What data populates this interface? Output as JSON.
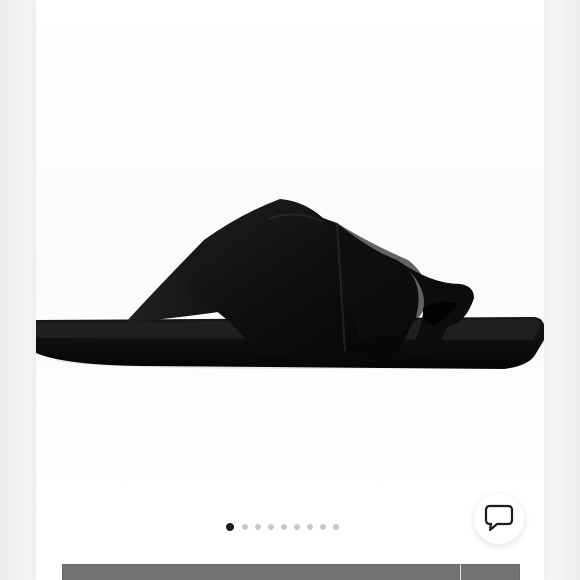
{
  "product": {
    "image_alt": "",
    "gallery": {
      "active_index": 0,
      "total": 9
    }
  },
  "chat": {
    "icon": "chat-bubble-icon"
  },
  "actions": {
    "primary_label": "",
    "secondary_label": ""
  }
}
